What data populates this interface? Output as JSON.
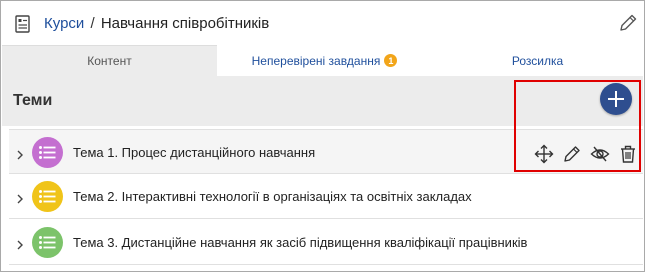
{
  "header": {
    "breadcrumb_link": "Курси",
    "separator": "/",
    "title": "Навчання співробітників"
  },
  "tabs": [
    {
      "label": "Контент"
    },
    {
      "label": "Неперевірені завдання",
      "badge": "1"
    },
    {
      "label": "Розсилка"
    }
  ],
  "section": {
    "title": "Теми"
  },
  "topics": [
    {
      "label": "Тема 1. Процес дистанційного навчання",
      "color": "#c46fd0"
    },
    {
      "label": "Тема 2. Інтерактивні технології в організаціях та освітніх закладах",
      "color": "#f0c419"
    },
    {
      "label": "Тема 3. Дистанційне навчання як засіб підвищення кваліфікації працівників",
      "color": "#7cc36a"
    }
  ],
  "colors": {
    "accent": "#2e4e8f",
    "link": "#1f4f9c",
    "badge": "#f2a51a",
    "highlight": "#e00000"
  },
  "icons": {
    "course": "course-doc-icon",
    "edit": "pencil-icon",
    "add": "plus-icon",
    "move": "move-icon",
    "hide": "eye-slash-icon",
    "delete": "trash-icon"
  }
}
